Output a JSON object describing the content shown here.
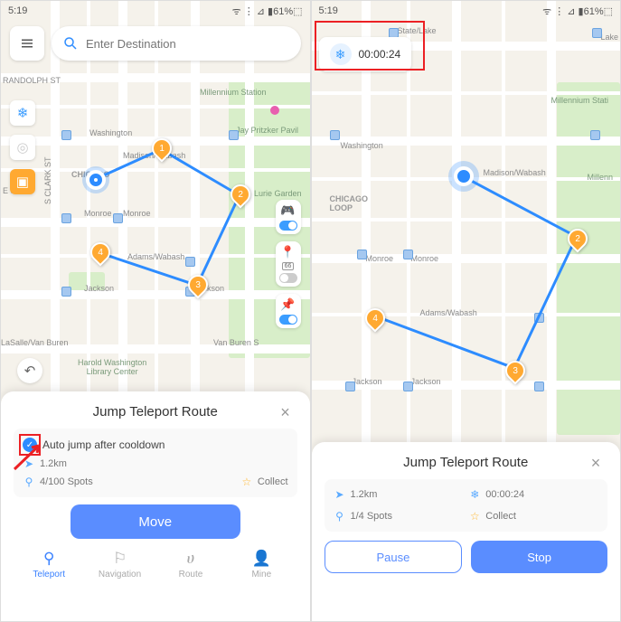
{
  "status": {
    "time": "5:19",
    "icons": "ᯤ ⋮ ⊿ ▮61%⬚"
  },
  "search": {
    "placeholder": "Enter Destination"
  },
  "left": {
    "sheet_title": "Jump Teleport Route",
    "auto_jump": "Auto jump after cooldown",
    "distance": "1.2km",
    "spots": "4/100 Spots",
    "collect": "Collect",
    "move_btn": "Move",
    "nav": {
      "teleport": "Teleport",
      "navigation": "Navigation",
      "route": "Route",
      "mine": "Mine"
    },
    "map": {
      "randolph": "RANDOLPH ST",
      "washington": "Washington",
      "e_st": "E ST",
      "madison_wabash": "Madison/Wabash",
      "monroe": "Monroe",
      "adams_wabash": "Adams/Wabash",
      "jackson": "Jackson",
      "lasalle": "LaSalle/Van Buren",
      "vanburen": "Van Buren S",
      "harold": "Harold Washington\nLibrary Center",
      "chicago": "CHICAGO",
      "millennium": "Millennium Station",
      "jay": "Jay Pritzker Pavil",
      "lurie": "Lurie Garden",
      "clark": "S CLARK ST"
    }
  },
  "right": {
    "timer": "00:00:24",
    "sheet_title": "Jump Teleport Route",
    "distance": "1.2km",
    "cooldown": "00:00:24",
    "spots": "1/4 Spots",
    "collect": "Collect",
    "pause": "Pause",
    "stop": "Stop",
    "map": {
      "state": "State/Lake",
      "lake": "Lake",
      "washington": "Washington",
      "madison_wabash": "Madison/Wabash",
      "chicago": "CHICAGO\nLOOP",
      "monroe": "Monroe",
      "adams_wabash": "Adams/Wabash",
      "jackson": "Jackson",
      "millennium": "Millennium Stati",
      "millen": "Millenn"
    }
  }
}
